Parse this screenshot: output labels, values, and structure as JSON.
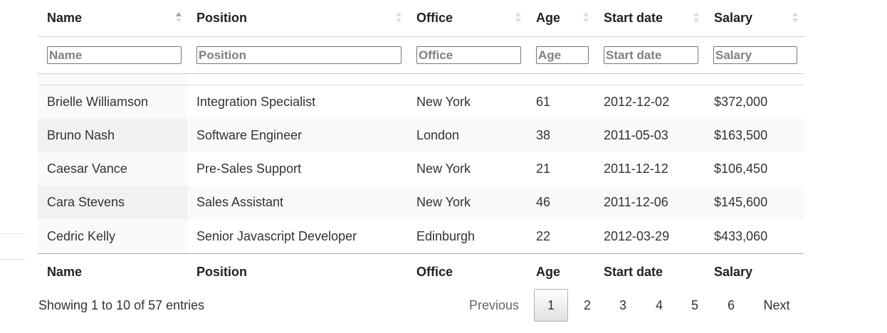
{
  "columns": {
    "name": "Name",
    "position": "Position",
    "office": "Office",
    "age": "Age",
    "start_date": "Start date",
    "salary": "Salary"
  },
  "filters": {
    "name_placeholder": "Name",
    "position_placeholder": "Position",
    "office_placeholder": "Office",
    "age_placeholder": "Age",
    "start_date_placeholder": "Start date",
    "salary_placeholder": "Salary"
  },
  "rows": [
    {
      "name": "Brielle Williamson",
      "position": "Integration Specialist",
      "office": "New York",
      "age": "61",
      "start_date": "2012-12-02",
      "salary": "$372,000"
    },
    {
      "name": "Bruno Nash",
      "position": "Software Engineer",
      "office": "London",
      "age": "38",
      "start_date": "2011-05-03",
      "salary": "$163,500"
    },
    {
      "name": "Caesar Vance",
      "position": "Pre-Sales Support",
      "office": "New York",
      "age": "21",
      "start_date": "2011-12-12",
      "salary": "$106,450"
    },
    {
      "name": "Cara Stevens",
      "position": "Sales Assistant",
      "office": "New York",
      "age": "46",
      "start_date": "2011-12-06",
      "salary": "$145,600"
    },
    {
      "name": "Cedric Kelly",
      "position": "Senior Javascript Developer",
      "office": "Edinburgh",
      "age": "22",
      "start_date": "2012-03-29",
      "salary": "$433,060"
    }
  ],
  "info": "Showing 1 to 10 of 57 entries",
  "pagination": {
    "previous": "Previous",
    "next": "Next",
    "pages": [
      "1",
      "2",
      "3",
      "4",
      "5",
      "6"
    ],
    "current": "1"
  },
  "sort": {
    "column": "name",
    "direction": "asc"
  }
}
